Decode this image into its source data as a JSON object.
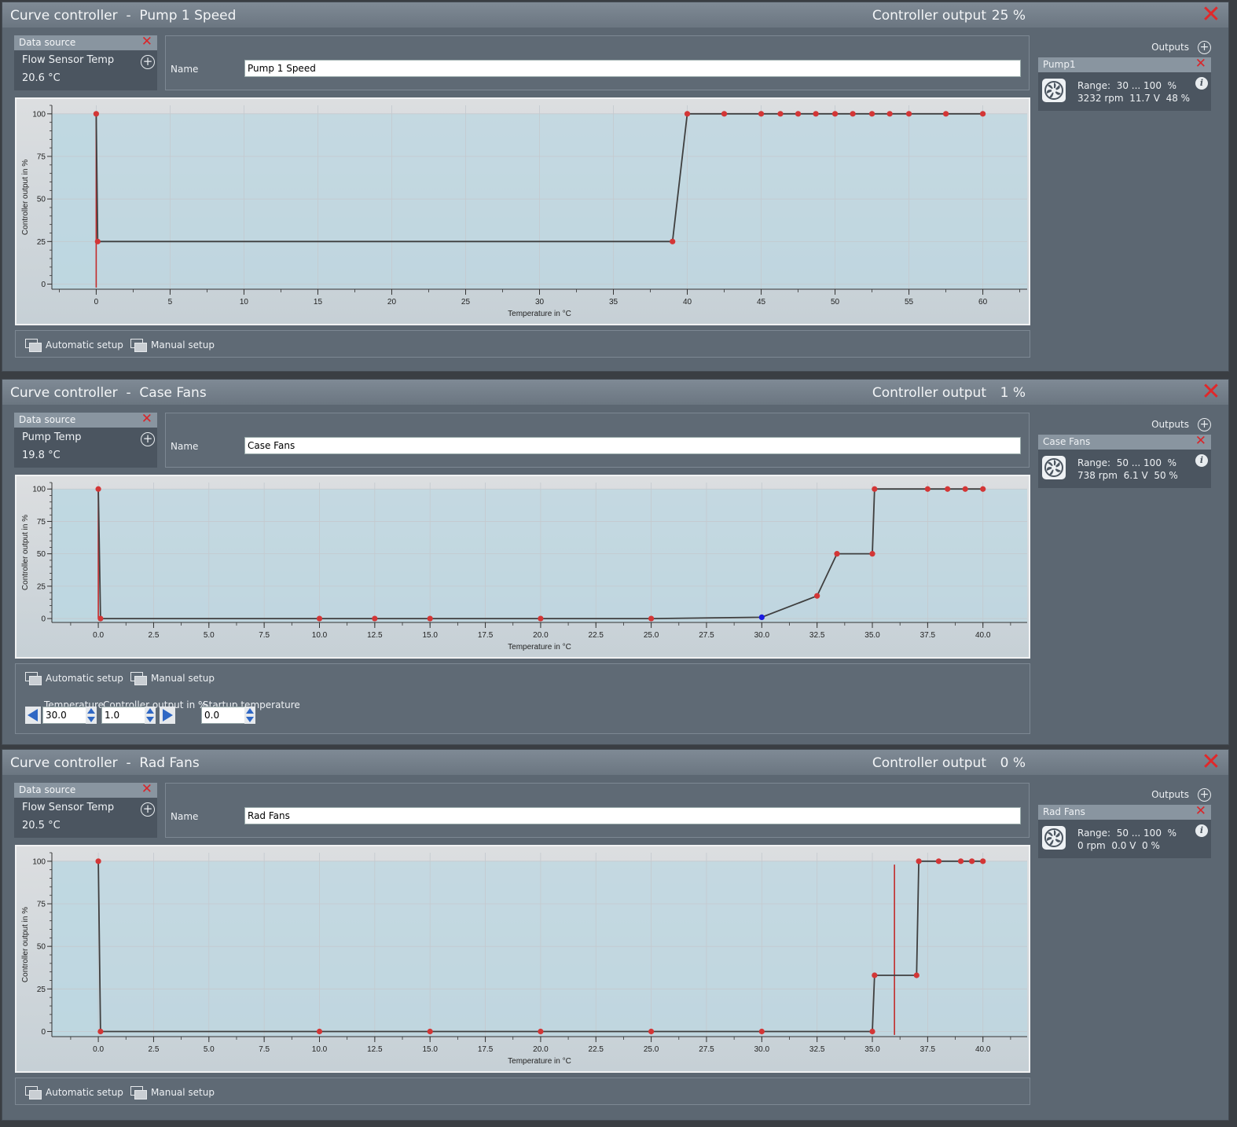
{
  "controllers": [
    {
      "title": "Curve controller  -  Pump 1 Speed",
      "output_label": "Controller output",
      "output_value": "25 %",
      "data_source": {
        "header": "Data source",
        "sensor": "Flow Sensor Temp",
        "value": "20.6 °C"
      },
      "name_label": "Name",
      "name_value": "Pump 1 Speed",
      "outputs_label": "Outputs",
      "output_card": {
        "name": "Pump1",
        "range": "Range:  30 ... 100  %",
        "stats": "3232 rpm  11.7 V  48 %"
      },
      "setup": {
        "auto": "Automatic setup",
        "manual": "Manual setup"
      }
    },
    {
      "title": "Curve controller  -  Case Fans",
      "output_label": "Controller output",
      "output_value": "1 %",
      "data_source": {
        "header": "Data source",
        "sensor": "Pump Temp",
        "value": "19.8 °C"
      },
      "name_label": "Name",
      "name_value": "Case Fans",
      "outputs_label": "Outputs",
      "output_card": {
        "name": "Case Fans",
        "range": "Range:  50 ... 100  %",
        "stats": "738 rpm  6.1 V  50 %"
      },
      "setup": {
        "auto": "Automatic setup",
        "manual": "Manual setup"
      },
      "editor": {
        "temperature_label": "Temperature",
        "temperature_value": "30.0",
        "output_label": "Controller output in %",
        "output_value": "1.0",
        "startup_label": "Startup temperature",
        "startup_value": "0.0"
      }
    },
    {
      "title": "Curve controller  -  Rad Fans",
      "output_label": "Controller output",
      "output_value": "0 %",
      "data_source": {
        "header": "Data source",
        "sensor": "Flow Sensor Temp",
        "value": "20.5 °C"
      },
      "name_label": "Name",
      "name_value": "Rad Fans",
      "outputs_label": "Outputs",
      "output_card": {
        "name": "Rad Fans",
        "range": "Range:  50 ... 100  %",
        "stats": "0 rpm  0.0 V  0 %"
      },
      "setup": {
        "auto": "Automatic setup",
        "manual": "Manual setup"
      }
    }
  ],
  "chart_data": [
    {
      "type": "line",
      "xlabel": "Temperature in °C",
      "ylabel": "Controller output in %",
      "xlim": [
        -3,
        63
      ],
      "ylim": [
        -3,
        105
      ],
      "xticks": [
        "0",
        "5",
        "10",
        "15",
        "20",
        "25",
        "30",
        "35",
        "40",
        "45",
        "50",
        "55",
        "60"
      ],
      "yticks": [
        "0",
        "25",
        "50",
        "75",
        "100"
      ],
      "x": [
        0,
        0.1,
        39,
        40,
        42.5,
        45,
        46.3,
        47.5,
        48.7,
        50,
        51.2,
        52.5,
        53.7,
        55,
        57.5,
        60
      ],
      "y": [
        100,
        25,
        25,
        100,
        100,
        100,
        100,
        100,
        100,
        100,
        100,
        100,
        100,
        100,
        100,
        100
      ],
      "selected_index": -1,
      "marker_x": 0,
      "marker_y_range": [
        -2,
        100
      ],
      "colors": {
        "line": "#3f3f3f",
        "point": "#d33636",
        "selected": "#1a1ae0",
        "marker": "#c22a2a",
        "fill": "#bcd7e1"
      }
    },
    {
      "type": "line",
      "xlabel": "Temperature in °C",
      "ylabel": "Controller output in %",
      "xlim": [
        -2.1,
        42
      ],
      "ylim": [
        -3,
        105
      ],
      "xticks": [
        "0.0",
        "2.5",
        "5.0",
        "7.5",
        "10.0",
        "12.5",
        "15.0",
        "17.5",
        "20.0",
        "22.5",
        "25.0",
        "27.5",
        "30.0",
        "32.5",
        "35.0",
        "37.5",
        "40.0"
      ],
      "yticks": [
        "0",
        "25",
        "50",
        "75",
        "100"
      ],
      "x": [
        0,
        0.1,
        10,
        12.5,
        15,
        20,
        25,
        30,
        32.5,
        33.4,
        35,
        35.1,
        37.5,
        38.4,
        39.2,
        40
      ],
      "y": [
        100,
        0,
        0,
        0,
        0,
        0,
        0,
        1,
        17.5,
        50,
        50,
        100,
        100,
        100,
        100,
        100
      ],
      "selected_index": 7,
      "marker_x": 0,
      "marker_y_range": [
        0,
        100
      ],
      "colors": {
        "line": "#3f3f3f",
        "point": "#d33636",
        "selected": "#1a1ae0",
        "marker": "#c22a2a",
        "fill": "#bcd7e1"
      }
    },
    {
      "type": "line",
      "xlabel": "Temperature in °C",
      "ylabel": "Controller output in %",
      "xlim": [
        -2.1,
        42
      ],
      "ylim": [
        -3,
        105
      ],
      "xticks": [
        "0.0",
        "2.5",
        "5.0",
        "7.5",
        "10.0",
        "12.5",
        "15.0",
        "17.5",
        "20.0",
        "22.5",
        "25.0",
        "27.5",
        "30.0",
        "32.5",
        "35.0",
        "37.5",
        "40.0"
      ],
      "yticks": [
        "0",
        "25",
        "50",
        "75",
        "100"
      ],
      "x": [
        0,
        0.1,
        10,
        15,
        20,
        25,
        30,
        35,
        35.1,
        37,
        37.1,
        38,
        39,
        39.5,
        40
      ],
      "y": [
        100,
        0,
        0,
        0,
        0,
        0,
        0,
        0,
        33,
        33,
        100,
        100,
        100,
        100,
        100
      ],
      "selected_index": -1,
      "marker_x": 36,
      "marker_y_range": [
        -2,
        98
      ],
      "colors": {
        "line": "#3f3f3f",
        "point": "#d33636",
        "selected": "#1a1ae0",
        "marker": "#c22a2a",
        "fill": "#bcd7e1"
      }
    }
  ]
}
